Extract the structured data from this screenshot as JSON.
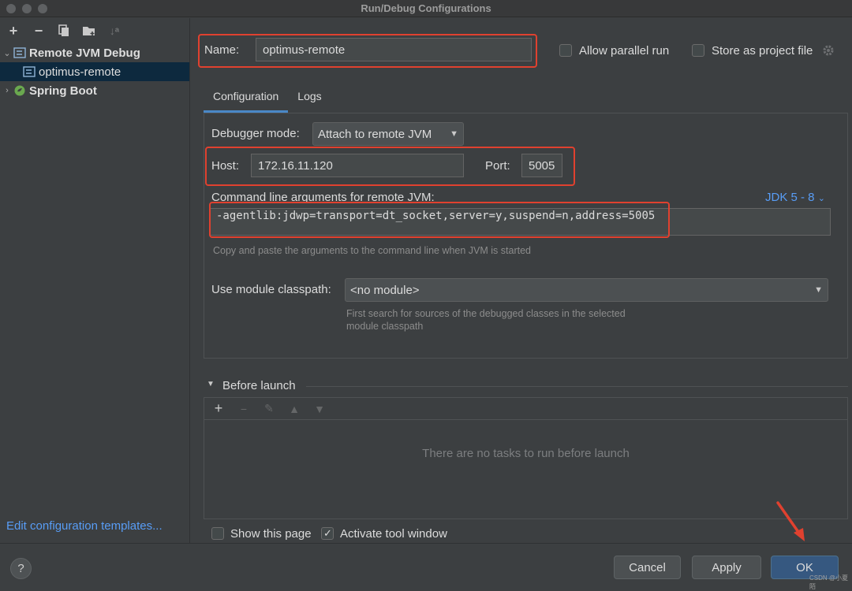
{
  "window": {
    "title": "Run/Debug Configurations"
  },
  "sidebar": {
    "toolbar": [
      "add",
      "remove",
      "copy",
      "folder",
      "sort"
    ],
    "tree": [
      {
        "label": "Remote JVM Debug",
        "expanded": true,
        "bold": true
      },
      {
        "label": "optimus-remote",
        "selected": true
      },
      {
        "label": "Spring Boot",
        "expanded": false,
        "bold": true
      }
    ],
    "edit_templates": "Edit configuration templates..."
  },
  "header": {
    "name_label": "Name:",
    "name_value": "optimus-remote",
    "allow_parallel": "Allow parallel run",
    "store_project": "Store as project file"
  },
  "tabs": [
    {
      "label": "Configuration",
      "active": true
    },
    {
      "label": "Logs",
      "active": false
    }
  ],
  "config": {
    "debugger_mode_label": "Debugger mode:",
    "debugger_mode_value": "Attach to remote JVM",
    "host_label": "Host:",
    "host_value": "172.16.11.120",
    "port_label": "Port:",
    "port_value": "5005",
    "cmdline_label": "Command line arguments for remote JVM:",
    "jdk_link": "JDK 5 - 8",
    "cmdline_value": "-agentlib:jdwp=transport=dt_socket,server=y,suspend=n,address=5005",
    "cmdline_hint": "Copy and paste the arguments to the command line when JVM is started",
    "module_label": "Use module classpath:",
    "module_value": "<no module>",
    "module_hint_1": "First search for sources of the debugged classes in the selected",
    "module_hint_2": "module classpath"
  },
  "before_launch": {
    "title": "Before launch",
    "empty_text": "There are no tasks to run before launch"
  },
  "options": {
    "show_page": "Show this page",
    "activate_tool": "Activate tool window"
  },
  "buttons": {
    "help": "?",
    "cancel": "Cancel",
    "apply": "Apply",
    "ok": "OK"
  },
  "watermark": "CSDN @小夏陌",
  "colors": {
    "accent": "#365880",
    "highlight": "#e0412f",
    "link": "#589df6"
  }
}
